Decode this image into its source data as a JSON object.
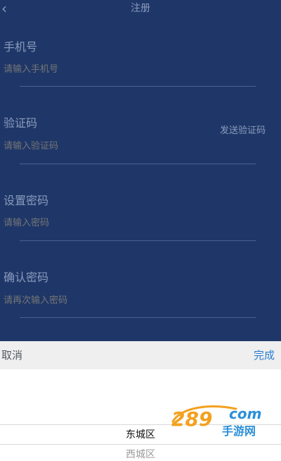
{
  "header": {
    "title": "注册",
    "back_icon": "chevron-left-icon"
  },
  "form": {
    "phone": {
      "label": "手机号",
      "placeholder": "请输入手机号"
    },
    "code": {
      "label": "验证码",
      "placeholder": "请输入验证码",
      "send_label": "发送验证码"
    },
    "password": {
      "label": "设置密码",
      "placeholder": "请输入密码"
    },
    "confirm": {
      "label": "确认密码",
      "placeholder": "请再次输入密码"
    }
  },
  "picker": {
    "cancel_label": "取消",
    "done_label": "完成",
    "selected_option": "东城区",
    "next_option": "西城区"
  },
  "watermark": {
    "logo_text": "289",
    "logo_suffix": "com",
    "logo_sub": "手游网"
  },
  "colors": {
    "form_bg": "#1f3768",
    "done_accent": "#2b7fd1",
    "toolbar_bg": "#efefef"
  }
}
